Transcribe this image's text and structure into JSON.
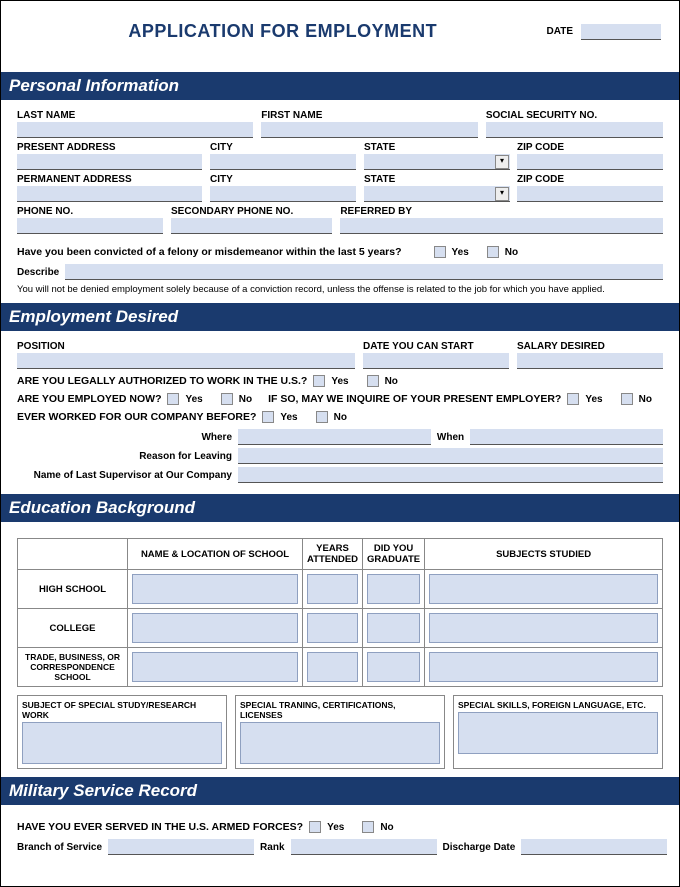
{
  "title": "APPLICATION FOR EMPLOYMENT",
  "date_label": "DATE",
  "sections": {
    "personal": {
      "title": "Personal Information",
      "last_name": "LAST NAME",
      "first_name": "FIRST NAME",
      "ssn": "SOCIAL SECURITY NO.",
      "present_address": "PRESENT ADDRESS",
      "city": "CITY",
      "state": "STATE",
      "zip": "ZIP CODE",
      "permanent_address": "PERMANENT ADDRESS",
      "phone": "PHONE NO.",
      "secondary_phone": "SECONDARY PHONE NO.",
      "referred_by": "REFERRED BY",
      "felony_q": "Have you been convicted of a felony or misdemeanor within the last 5 years?",
      "yes": "Yes",
      "no": "No",
      "describe": "Describe",
      "disclaimer": "You will not be denied employment solely because of a conviction record, unless the offense is related to the job for which you have applied."
    },
    "employment": {
      "title": "Employment Desired",
      "position": "POSITION",
      "date_start": "DATE YOU CAN START",
      "salary": "SALARY DESIRED",
      "authorized_q": "ARE YOU LEGALLY AUTHORIZED TO WORK IN THE U.S.?",
      "employed_q": "ARE YOU EMPLOYED NOW?",
      "inquire_q": "IF SO, MAY WE INQUIRE OF YOUR PRESENT EMPLOYER?",
      "worked_before_q": "EVER WORKED FOR OUR COMPANY BEFORE?",
      "where": "Where",
      "when": "When",
      "reason": "Reason for Leaving",
      "supervisor": "Name of Last Supervisor at Our Company",
      "yes": "Yes",
      "no": "No"
    },
    "education": {
      "title": "Education Background",
      "col_name": "NAME & LOCATION OF SCHOOL",
      "col_years": "YEARS ATTENDED",
      "col_grad": "DID YOU GRADUATE",
      "col_subjects": "SUBJECTS STUDIED",
      "row_hs": "HIGH SCHOOL",
      "row_college": "COLLEGE",
      "row_trade": "TRADE, BUSINESS, OR CORRESPONDENCE SCHOOL",
      "special_study": "SUBJECT OF SPECIAL STUDY/RESEARCH WORK",
      "special_training": "SPECIAL TRANING, CERTIFICATIONS, LICENSES",
      "special_skills": "SPECIAL SKILLS, FOREIGN LANGUAGE, ETC."
    },
    "military": {
      "title": "Military Service Record",
      "served_q": "HAVE YOU EVER SERVED IN THE U.S. ARMED FORCES?",
      "branch": "Branch of Service",
      "rank": "Rank",
      "discharge": "Discharge Date",
      "yes": "Yes",
      "no": "No"
    }
  }
}
